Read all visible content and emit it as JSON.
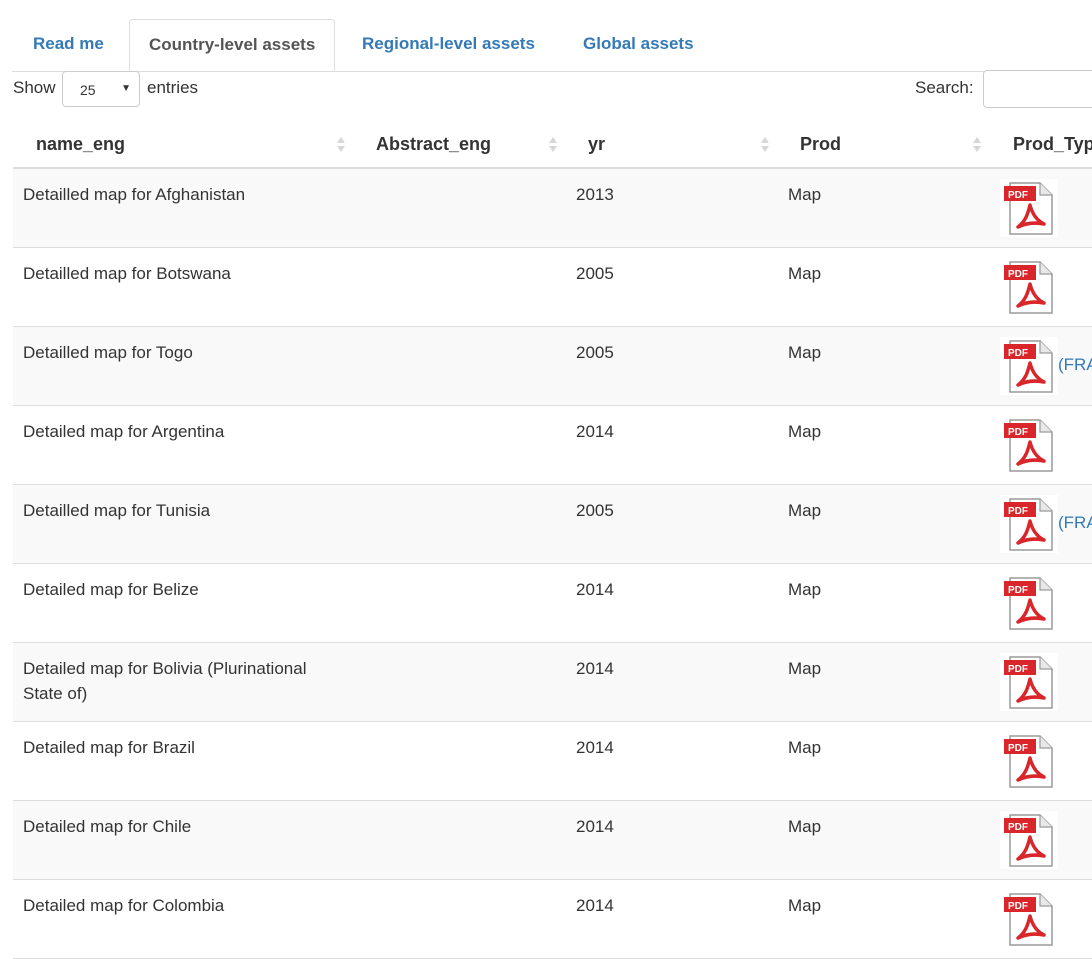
{
  "tabs": [
    {
      "label": "Read me",
      "active": false
    },
    {
      "label": "Country-level assets",
      "active": true
    },
    {
      "label": "Regional-level assets",
      "active": false
    },
    {
      "label": "Global assets",
      "active": false
    }
  ],
  "length": {
    "show_label": "Show",
    "value": "25",
    "entries_label": "entries"
  },
  "search": {
    "label": "Search:",
    "placeholder": ""
  },
  "columns": [
    "name_eng",
    "Abstract_eng",
    "yr",
    "Prod",
    "Prod_Typ"
  ],
  "rows": [
    {
      "name": "Detailled map for Afghanistan",
      "abstract": "",
      "yr": "2013",
      "prod": "Map",
      "type_icon": "pdf-icon",
      "extra": ""
    },
    {
      "name": "Detailled map for Botswana",
      "abstract": "",
      "yr": "2005",
      "prod": "Map",
      "type_icon": "pdf-icon",
      "extra": ""
    },
    {
      "name": "Detailled map for Togo",
      "abstract": "",
      "yr": "2005",
      "prod": "Map",
      "type_icon": "pdf-icon",
      "extra": "(FRA"
    },
    {
      "name": "Detailed map for Argentina",
      "abstract": "",
      "yr": "2014",
      "prod": "Map",
      "type_icon": "pdf-icon",
      "extra": ""
    },
    {
      "name": "Detailled map for Tunisia",
      "abstract": "",
      "yr": "2005",
      "prod": "Map",
      "type_icon": "pdf-icon",
      "extra": "(FRA"
    },
    {
      "name": "Detailed map for Belize",
      "abstract": "",
      "yr": "2014",
      "prod": "Map",
      "type_icon": "pdf-icon",
      "extra": ""
    },
    {
      "name": "Detailed map for Bolivia (Plurinational State of)",
      "abstract": "",
      "yr": "2014",
      "prod": "Map",
      "type_icon": "pdf-icon",
      "extra": ""
    },
    {
      "name": "Detailed map for Brazil",
      "abstract": "",
      "yr": "2014",
      "prod": "Map",
      "type_icon": "pdf-icon",
      "extra": ""
    },
    {
      "name": "Detailed map for Chile",
      "abstract": "",
      "yr": "2014",
      "prod": "Map",
      "type_icon": "pdf-icon",
      "extra": ""
    },
    {
      "name": "Detailed map for Colombia",
      "abstract": "",
      "yr": "2014",
      "prod": "Map",
      "type_icon": "pdf-icon",
      "extra": ""
    }
  ],
  "colors": {
    "link": "#337ab7",
    "pdf_red": "#d9262a",
    "border": "#dddddd",
    "stripe": "#f9f9f9"
  }
}
